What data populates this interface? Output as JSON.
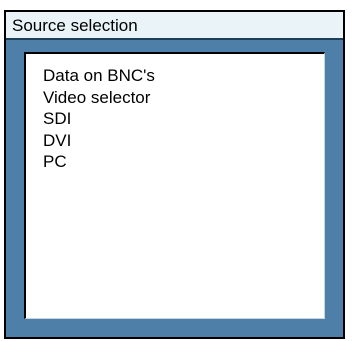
{
  "panel": {
    "title": "Source selection"
  },
  "sources": {
    "items": [
      {
        "label": "Data on BNC's"
      },
      {
        "label": "Video selector"
      },
      {
        "label": "SDI"
      },
      {
        "label": "DVI"
      },
      {
        "label": "PC"
      }
    ]
  },
  "colors": {
    "panel_background": "#4d7fa8",
    "header_background": "#e9f3f8",
    "list_background": "#ffffff"
  }
}
